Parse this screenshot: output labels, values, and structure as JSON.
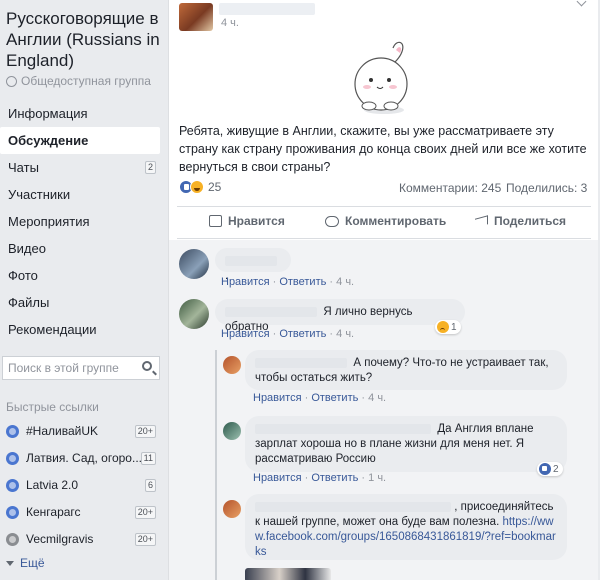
{
  "sidebar": {
    "group_title": "Русскоговорящие в Англии (Russians in England)",
    "privacy": "Общедоступная группа",
    "nav": [
      {
        "label": "Информация",
        "badge": ""
      },
      {
        "label": "Обсуждение",
        "badge": "",
        "active": true
      },
      {
        "label": "Чаты",
        "badge": "2"
      },
      {
        "label": "Участники",
        "badge": ""
      },
      {
        "label": "Мероприятия",
        "badge": ""
      },
      {
        "label": "Видео",
        "badge": ""
      },
      {
        "label": "Фото",
        "badge": ""
      },
      {
        "label": "Файлы",
        "badge": ""
      },
      {
        "label": "Рекомендации",
        "badge": ""
      }
    ],
    "search_placeholder": "Поиск в этой группе",
    "quick_links_title": "Быстрые ссылки",
    "quick_links": [
      {
        "label": "#НаливайUK",
        "badge": "20+"
      },
      {
        "label": "Латвия. Сад, огоро...",
        "badge": "11"
      },
      {
        "label": "Latvia 2.0",
        "badge": "6"
      },
      {
        "label": "Кенгарагс",
        "badge": "20+"
      },
      {
        "label": "Vecmilgravis",
        "badge": "20+"
      }
    ],
    "more_label": "Ещё"
  },
  "post": {
    "time": "4 ч.",
    "text": "Ребята, живущие в Англии, скажите, вы уже рассматриваете эту страну как страну проживания до конца своих дней или все же хотите вернуться в свои страны?",
    "reaction_count": "25",
    "comments_label": "Комментарии: 245",
    "shares_label": "Поделились: 3",
    "actions": {
      "like": "Нравится",
      "comment": "Комментировать",
      "share": "Поделиться"
    }
  },
  "comments": [
    {
      "text": ".",
      "like": "Нравится",
      "reply": "Ответить",
      "time": "4 ч."
    },
    {
      "text": "Я лично вернусь обратно",
      "like": "Нравится",
      "reply": "Ответить",
      "time": "4 ч.",
      "reaction_count": "1"
    },
    {
      "text": "А почему? Что-то не устраивает так, чтобы остаться жить?",
      "like": "Нравится",
      "reply": "Ответить",
      "time": "4 ч."
    },
    {
      "text": "Да Англия вплане зарплат хороша но в плане жизни для меня нет. Я рассматриваю Россию",
      "like": "Нравится",
      "reply": "Ответить",
      "time": "1 ч.",
      "reaction_count": "2"
    },
    {
      "text": ", присоединяйтесь к нашей группе, может она буде вам полезна.",
      "link": "https://www.facebook.com/groups/1650868431861819/?ref=bookmarks"
    }
  ],
  "colors": {
    "link": "#385898",
    "muted": "#90949c",
    "like_blue": "#4267b2"
  }
}
